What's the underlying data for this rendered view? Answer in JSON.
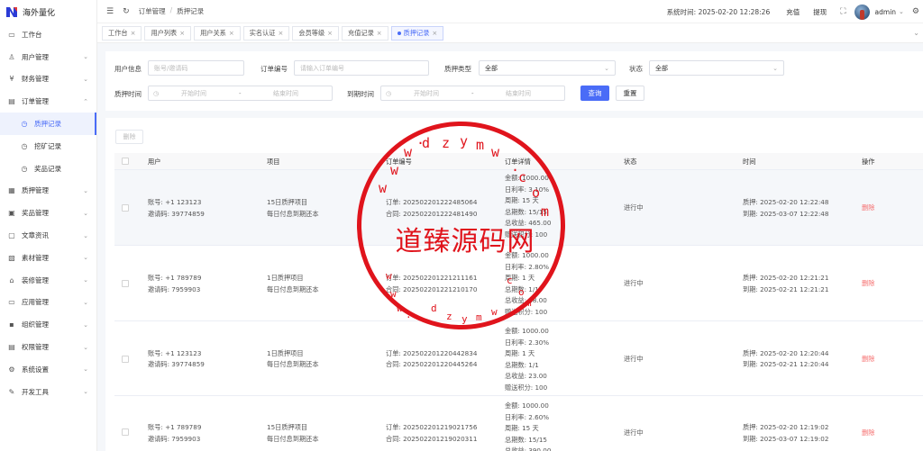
{
  "app": {
    "title": "海外量化"
  },
  "sidebar": {
    "items": [
      {
        "label": "工作台",
        "icon": "monitor-icon",
        "glyph": "▭",
        "sub": false,
        "arrow": false,
        "active": false
      },
      {
        "label": "用户管理",
        "icon": "user-icon",
        "glyph": "♙",
        "sub": false,
        "arrow": true,
        "active": false
      },
      {
        "label": "财务管理",
        "icon": "finance-icon",
        "glyph": "¥",
        "sub": false,
        "arrow": true,
        "active": false
      },
      {
        "label": "订单管理",
        "icon": "order-icon",
        "glyph": "▤",
        "sub": false,
        "arrow": true,
        "active": false,
        "expanded": true
      },
      {
        "label": "质押记录",
        "icon": "clock-icon",
        "glyph": "◷",
        "sub": true,
        "arrow": false,
        "active": true
      },
      {
        "label": "挖矿记录",
        "icon": "clock-icon",
        "glyph": "◷",
        "sub": true,
        "arrow": false,
        "active": false
      },
      {
        "label": "奖品记录",
        "icon": "clock-icon",
        "glyph": "◷",
        "sub": true,
        "arrow": false,
        "active": false
      },
      {
        "label": "质押管理",
        "icon": "stake-icon",
        "glyph": "▦",
        "sub": false,
        "arrow": true,
        "active": false
      },
      {
        "label": "奖品管理",
        "icon": "gift-icon",
        "glyph": "▣",
        "sub": false,
        "arrow": true,
        "active": false
      },
      {
        "label": "文章资讯",
        "icon": "article-icon",
        "glyph": "▢",
        "sub": false,
        "arrow": true,
        "active": false
      },
      {
        "label": "素材管理",
        "icon": "material-icon",
        "glyph": "▧",
        "sub": false,
        "arrow": true,
        "active": false
      },
      {
        "label": "装修管理",
        "icon": "decorate-icon",
        "glyph": "⌂",
        "sub": false,
        "arrow": true,
        "active": false
      },
      {
        "label": "应用管理",
        "icon": "app-icon",
        "glyph": "▭",
        "sub": false,
        "arrow": true,
        "active": false
      },
      {
        "label": "组织管理",
        "icon": "org-icon",
        "glyph": "▪",
        "sub": false,
        "arrow": true,
        "active": false
      },
      {
        "label": "权限管理",
        "icon": "permission-icon",
        "glyph": "▤",
        "sub": false,
        "arrow": true,
        "active": false
      },
      {
        "label": "系统设置",
        "icon": "gear-icon",
        "glyph": "⚙",
        "sub": false,
        "arrow": true,
        "active": false
      },
      {
        "label": "开发工具",
        "icon": "tool-icon",
        "glyph": "✎",
        "sub": false,
        "arrow": true,
        "active": false
      }
    ]
  },
  "header": {
    "breadcrumb": [
      "订单管理",
      "/",
      "质押记录"
    ],
    "system_time": "系统时间: 2025-02-20 12:28:26",
    "recharge": "充值",
    "withdraw": "提现",
    "username": "admin"
  },
  "tabs": [
    {
      "label": "工作台",
      "active": false
    },
    {
      "label": "用户列表",
      "active": false
    },
    {
      "label": "用户关系",
      "active": false
    },
    {
      "label": "实名认证",
      "active": false
    },
    {
      "label": "会员等级",
      "active": false
    },
    {
      "label": "充值记录",
      "active": false
    },
    {
      "label": "质押记录",
      "active": true
    }
  ],
  "filters": {
    "user_label": "用户信息",
    "user_placeholder": "账号/邀请码",
    "order_label": "订单编号",
    "order_placeholder": "请输入订单编号",
    "type_label": "质押类型",
    "type_value": "全部",
    "status_label": "状态",
    "status_value": "全部",
    "stake_time_label": "质押时间",
    "expire_time_label": "到期时间",
    "start_placeholder": "开始时间",
    "end_placeholder": "结束时间",
    "range_sep": "-",
    "search": "查询",
    "reset": "重置"
  },
  "table": {
    "delete_label": "删除",
    "columns": [
      "用户",
      "项目",
      "订单编号",
      "订单详情",
      "状态",
      "时间",
      "操作"
    ],
    "rows": [
      {
        "user": [
          "账号: +1 123123",
          "邀请码: 39774859"
        ],
        "project": [
          "15日质押项目",
          "每日付息到期还本"
        ],
        "order": [
          "订单: 202502201222485064",
          "合同: 202502201222481490"
        ],
        "details": [
          "金额: 1000.00",
          "日利率: 3.10%",
          "周期: 15 天",
          "总期数: 15/15",
          "总收益: 465.00",
          "赠送积分: 100"
        ],
        "status": "进行中",
        "time": [
          "质押: 2025-02-20 12:22:48",
          "到期: 2025-03-07 12:22:48"
        ],
        "op": "删除"
      },
      {
        "user": [
          "账号: +1 789789",
          "邀请码: 7959903"
        ],
        "project": [
          "1日质押项目",
          "每日付息到期还本"
        ],
        "order": [
          "订单: 202502201221211161",
          "合同: 202502201221210170"
        ],
        "details": [
          "金额: 1000.00",
          "日利率: 2.80%",
          "周期: 1 天",
          "总期数: 1/1",
          "总收益: 28.00",
          "赠送积分: 100"
        ],
        "status": "进行中",
        "time": [
          "质押: 2025-02-20 12:21:21",
          "到期: 2025-02-21 12:21:21"
        ],
        "op": "删除"
      },
      {
        "user": [
          "账号: +1 123123",
          "邀请码: 39774859"
        ],
        "project": [
          "1日质押项目",
          "每日付息到期还本"
        ],
        "order": [
          "订单: 202502201220442834",
          "合同: 202502201220445264"
        ],
        "details": [
          "金额: 1000.00",
          "日利率: 2.30%",
          "周期: 1 天",
          "总期数: 1/1",
          "总收益: 23.00",
          "赠送积分: 100"
        ],
        "status": "进行中",
        "time": [
          "质押: 2025-02-20 12:20:44",
          "到期: 2025-02-21 12:20:44"
        ],
        "op": "删除"
      },
      {
        "user": [
          "账号: +1 789789",
          "邀请码: 7959903"
        ],
        "project": [
          "15日质押项目",
          "每日付息到期还本"
        ],
        "order": [
          "订单: 202502201219021756",
          "合同: 202502201219020311"
        ],
        "details": [
          "金额: 1000.00",
          "日利率: 2.60%",
          "周期: 15 天",
          "总期数: 15/15",
          "总收益: 390.00"
        ],
        "status": "进行中",
        "time": [
          "质押: 2025-02-20 12:19:02",
          "到期: 2025-03-07 12:19:02"
        ],
        "op": "删除"
      }
    ]
  },
  "watermark": {
    "text": "道臻源码网",
    "top_chars": [
      "w",
      "w",
      "w",
      "·",
      "d",
      "z",
      "y",
      "m",
      "w",
      "·",
      "c",
      "o",
      "m"
    ],
    "bottom_chars": [
      "w",
      "w",
      "w",
      "·",
      "d",
      "z",
      "y",
      "m",
      "w",
      "·",
      "c",
      "o",
      "m"
    ],
    "color": "#e0141c"
  },
  "colors": {
    "accent": "#4a6cf7",
    "danger": "#f56c6c"
  }
}
